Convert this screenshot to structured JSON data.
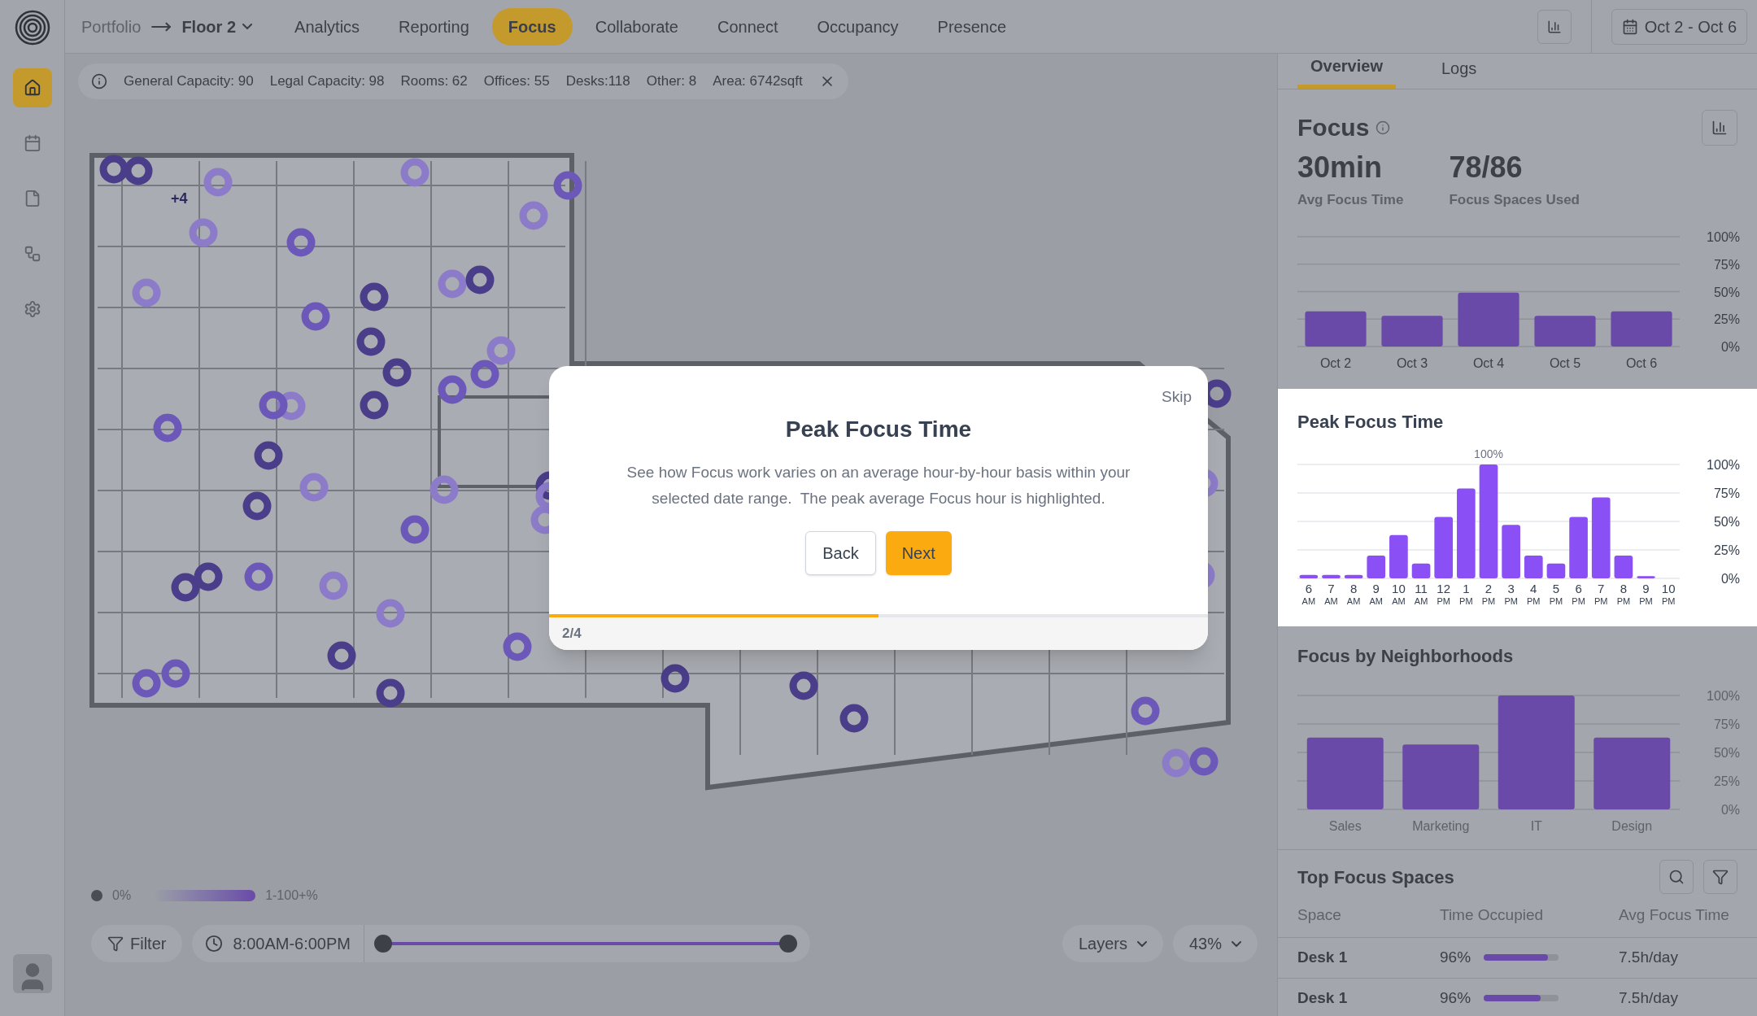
{
  "sidebar": {
    "items": [
      {
        "selected": true
      },
      {
        "selected": false
      },
      {
        "selected": false
      },
      {
        "selected": false
      },
      {
        "selected": false
      }
    ]
  },
  "breadcrumb": {
    "parent": "Portfolio",
    "current": "Floor 2"
  },
  "nav_tabs": [
    {
      "label": "Analytics",
      "selected": false
    },
    {
      "label": "Reporting",
      "selected": false
    },
    {
      "label": "Focus",
      "selected": true
    },
    {
      "label": "Collaborate",
      "selected": false
    },
    {
      "label": "Connect",
      "selected": false
    },
    {
      "label": "Occupancy",
      "selected": false
    },
    {
      "label": "Presence",
      "selected": false
    }
  ],
  "date_range": "Oct 2 - Oct 6",
  "info_bar": [
    "General Capacity: 90",
    "Legal Capacity: 98",
    "Rooms: 62",
    "Offices: 55",
    "Desks:118",
    "Other: 8",
    "Area: 6742sqft"
  ],
  "map": {
    "cluster_badge": "+4"
  },
  "legend": {
    "empty": "0%",
    "range": "1-100+%"
  },
  "controls": {
    "filter": "Filter",
    "time": "8:00AM-6:00PM",
    "slider_start": {
      "level": 0
    },
    "slider_end": {
      "level": 1
    },
    "layers": "Layers",
    "zoom": "43%"
  },
  "tour": {
    "skip": "Skip",
    "title": "Peak Focus Time",
    "body": "See how Focus work varies on an average hour-by-hour basis within your selected date range.  The peak average Focus hour is highlighted.",
    "back": "Back",
    "next": "Next",
    "step": "2/4",
    "level": 0.5
  },
  "panel_tabs": [
    {
      "label": "Overview",
      "selected": true
    },
    {
      "label": "Logs",
      "selected": false
    }
  ],
  "focus": {
    "title": "Focus",
    "stats": [
      {
        "value": "30min",
        "label": "Avg Focus Time"
      },
      {
        "value": "78/86",
        "label": "Focus Spaces Used"
      }
    ],
    "chart_data": {
      "type": "bar",
      "categories": [
        "Oct 2",
        "Oct 3",
        "Oct 4",
        "Oct 5",
        "Oct 6"
      ],
      "series": [
        {
          "color": "#6a4aa8",
          "values": [
            32,
            28,
            49,
            28,
            32
          ]
        }
      ],
      "ylim": [
        0,
        100
      ],
      "grid": true,
      "yticks": [
        {
          "value": 0,
          "label": "0%"
        },
        {
          "value": 25,
          "label": "25%"
        },
        {
          "value": 50,
          "label": "50%"
        },
        {
          "value": 75,
          "label": "75%"
        },
        {
          "value": 100,
          "label": "100%"
        }
      ]
    }
  },
  "peak": {
    "title": "Peak Focus Time",
    "chart_data": {
      "type": "bar",
      "categories": [
        "6 $_{AM}$",
        "7 $_{AM}$",
        "8 $_{AM}$",
        "9 $_{AM}$",
        "10 $_{AM}$",
        "11 $_{AM}$",
        "12 $_{PM}$",
        "1 $_{PM}$",
        "2 $_{PM}$",
        "3 $_{PM}$",
        "4 $_{PM}$",
        "5 $_{PM}$",
        "6 $_{PM}$",
        "7 $_{PM}$",
        "8 $_{PM}$",
        "9 $_{PM}$",
        "10 $_{PM}$"
      ],
      "series": [
        {
          "color": "#8b50f5",
          "values": [
            3,
            3,
            3,
            20,
            38,
            13,
            54,
            79,
            100,
            47,
            20,
            13,
            54,
            71,
            20,
            2,
            null
          ]
        }
      ],
      "ylim": [
        0,
        100
      ],
      "grid": true,
      "yticks": [
        {
          "value": 0,
          "label": "0%"
        },
        {
          "value": 25,
          "label": "25%"
        },
        {
          "value": 50,
          "label": "50%"
        },
        {
          "value": 75,
          "label": "75%"
        },
        {
          "value": 100,
          "label": "100%"
        }
      ],
      "annotations": [
        {
          "x": "2 $_{PM}$",
          "y": 100,
          "text": "100%"
        }
      ]
    }
  },
  "neighborhoods": {
    "title": "Focus by Neighborhoods",
    "chart_data": {
      "type": "bar",
      "categories": [
        "Sales",
        "Marketing",
        "IT",
        "Design"
      ],
      "series": [
        {
          "color": "#6a4aa8",
          "values": [
            63,
            57,
            100,
            63
          ]
        }
      ],
      "ylim": [
        0,
        100
      ],
      "grid": true,
      "yticks": [
        {
          "value": 0,
          "label": "0%"
        },
        {
          "value": 25,
          "label": "25%"
        },
        {
          "value": 50,
          "label": "50%"
        },
        {
          "value": 75,
          "label": "75%"
        },
        {
          "value": 100,
          "label": "100%"
        }
      ]
    }
  },
  "top_spaces": {
    "title": "Top Focus Spaces",
    "columns": [
      "Space",
      "Time Occupied",
      "Avg Focus Time"
    ],
    "rows": [
      {
        "space": "Desk 1",
        "occupied": "96%",
        "level": 0.86,
        "avg": "7.5h/day"
      },
      {
        "space": "Desk 1",
        "occupied": "96%",
        "level": 0.76,
        "avg": "7.5h/day"
      }
    ]
  }
}
